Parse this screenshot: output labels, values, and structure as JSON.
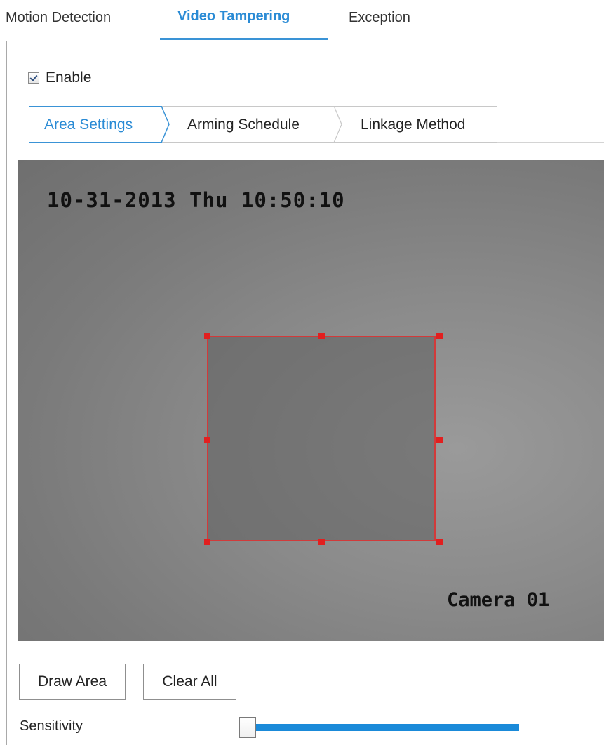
{
  "main_tabs": [
    {
      "label": "Motion Detection",
      "active": false
    },
    {
      "label": "Video Tampering",
      "active": true
    },
    {
      "label": "Exception",
      "active": false
    }
  ],
  "enable": {
    "label": "Enable",
    "checked": true
  },
  "sub_tabs": [
    {
      "label": "Area Settings",
      "active": true
    },
    {
      "label": "Arming Schedule",
      "active": false
    },
    {
      "label": "Linkage Method",
      "active": false
    }
  ],
  "video": {
    "datetime": "10-31-2013 Thu 10:50:10",
    "camera_name": "Camera 01"
  },
  "buttons": {
    "draw_area": "Draw Area",
    "clear_all": "Clear All"
  },
  "sensitivity": {
    "label": "Sensitivity",
    "value_fraction": 0.0
  },
  "colors": {
    "accent": "#2a8bd5",
    "slider_fill": "#1a8ad9",
    "area_outline": "#d23a3a",
    "area_handle": "#e21f1f"
  },
  "icons": {
    "checkbox": "check-icon"
  }
}
